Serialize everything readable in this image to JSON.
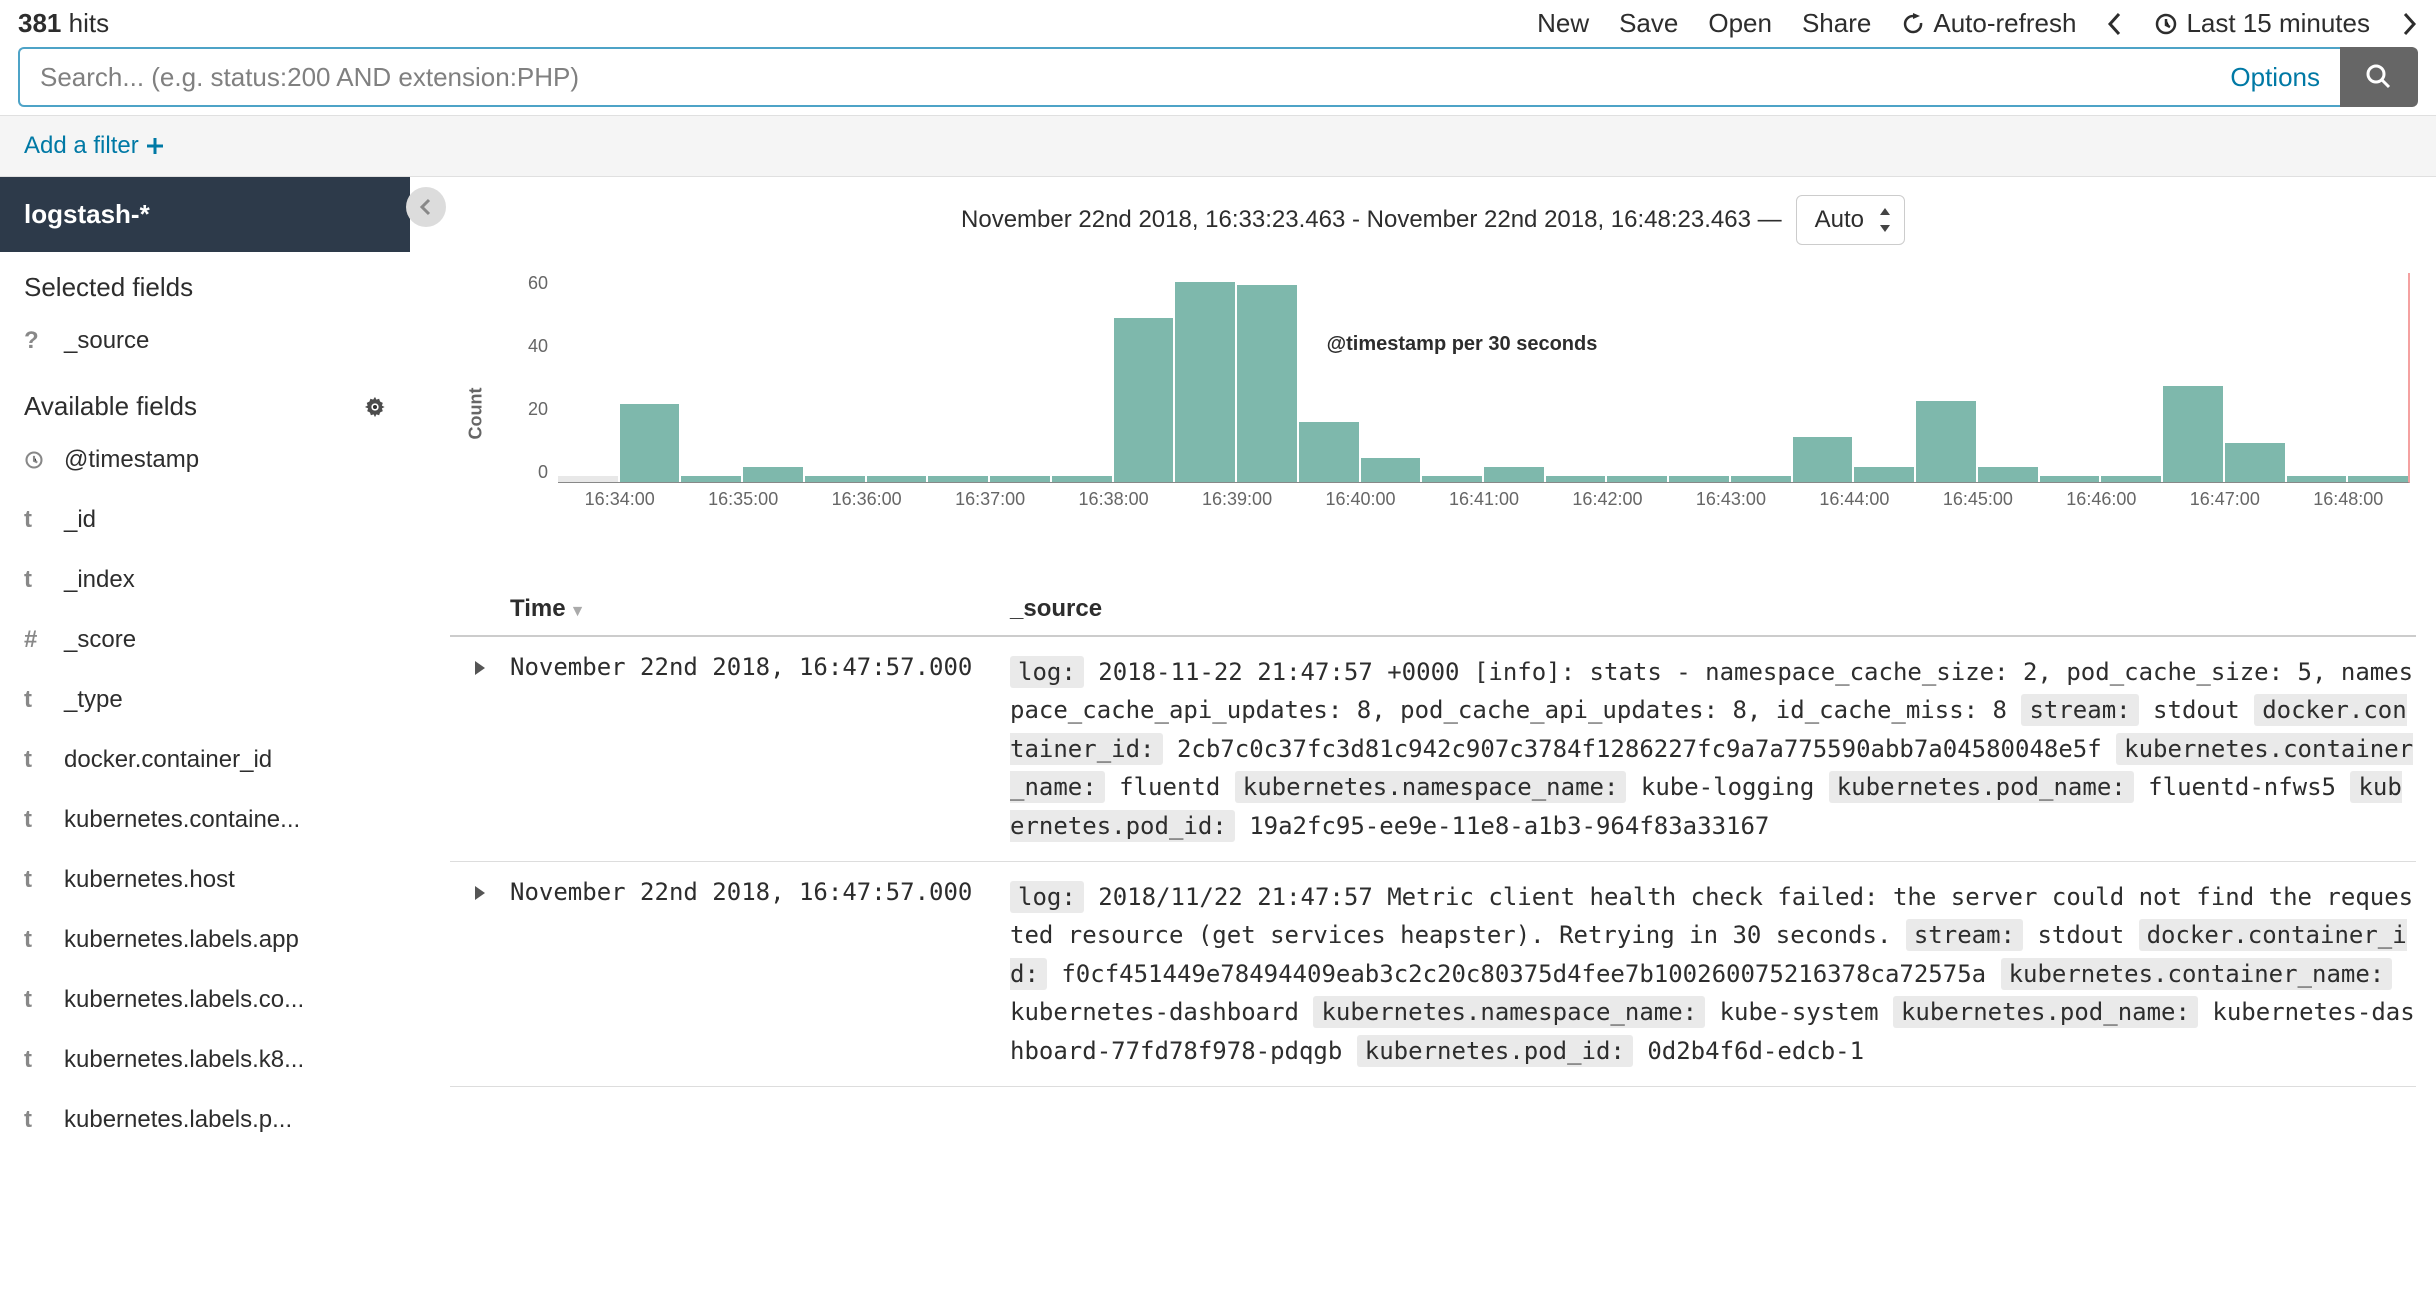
{
  "header": {
    "hit_count": "381",
    "hit_label": "hits",
    "menu": {
      "new": "New",
      "save": "Save",
      "open": "Open",
      "share": "Share",
      "auto_refresh": "Auto-refresh",
      "time_range": "Last 15 minutes"
    }
  },
  "search": {
    "placeholder": "Search... (e.g. status:200 AND extension:PHP)",
    "options": "Options"
  },
  "filter": {
    "add": "Add a filter"
  },
  "sidebar": {
    "index_pattern": "logstash-*",
    "selected_title": "Selected fields",
    "selected": [
      {
        "type": "?",
        "name": "_source"
      }
    ],
    "available_title": "Available fields",
    "available": [
      {
        "type": "clock",
        "name": "@timestamp"
      },
      {
        "type": "t",
        "name": "_id"
      },
      {
        "type": "t",
        "name": "_index"
      },
      {
        "type": "#",
        "name": "_score"
      },
      {
        "type": "t",
        "name": "_type"
      },
      {
        "type": "t",
        "name": "docker.container_id"
      },
      {
        "type": "t",
        "name": "kubernetes.containe..."
      },
      {
        "type": "t",
        "name": "kubernetes.host"
      },
      {
        "type": "t",
        "name": "kubernetes.labels.app"
      },
      {
        "type": "t",
        "name": "kubernetes.labels.co..."
      },
      {
        "type": "t",
        "name": "kubernetes.labels.k8..."
      },
      {
        "type": "t",
        "name": "kubernetes.labels.p..."
      }
    ]
  },
  "histogram": {
    "title": "November 22nd 2018, 16:33:23.463 - November 22nd 2018, 16:48:23.463 —",
    "interval": "Auto",
    "ylabel": "Count",
    "xaxis_label": "@timestamp per 30 seconds"
  },
  "chart_data": {
    "type": "bar",
    "categories": [
      "16:33:30",
      "16:34:00",
      "16:34:30",
      "16:35:00",
      "16:35:30",
      "16:36:00",
      "16:36:30",
      "16:37:00",
      "16:37:30",
      "16:38:00",
      "16:38:30",
      "16:39:00",
      "16:39:30",
      "16:40:00",
      "16:40:30",
      "16:41:00",
      "16:41:30",
      "16:42:00",
      "16:42:30",
      "16:43:00",
      "16:43:30",
      "16:44:00",
      "16:44:30",
      "16:45:00",
      "16:45:30",
      "16:46:00",
      "16:46:30",
      "16:47:00",
      "16:47:30",
      "16:48:00"
    ],
    "values": [
      2,
      26,
      2,
      5,
      2,
      2,
      2,
      2,
      2,
      55,
      67,
      66,
      20,
      8,
      2,
      5,
      2,
      2,
      2,
      2,
      15,
      5,
      27,
      5,
      2,
      2,
      32,
      13,
      2,
      2
    ],
    "xticks": [
      "16:34:00",
      "16:35:00",
      "16:36:00",
      "16:37:00",
      "16:38:00",
      "16:39:00",
      "16:40:00",
      "16:41:00",
      "16:42:00",
      "16:43:00",
      "16:44:00",
      "16:45:00",
      "16:46:00",
      "16:47:00",
      "16:48:00"
    ],
    "yticks": [
      "60",
      "40",
      "20",
      "0"
    ],
    "ylim": [
      0,
      70
    ],
    "xlabel": "@timestamp per 30 seconds",
    "ylabel": "Count",
    "title": "November 22nd 2018, 16:33:23.463 - November 22nd 2018, 16:48:23.463"
  },
  "table": {
    "columns": {
      "time": "Time",
      "source": "_source"
    },
    "rows": [
      {
        "time": "November 22nd 2018, 16:47:57.000",
        "fields": [
          {
            "k": "log:",
            "v": "2018-11-22 21:47:57 +0000 [info]: stats - namespace_cache_size: 2, pod_cache_size: 5, namespace_cache_api_updates: 8, pod_cache_api_updates: 8, id_cache_miss: 8"
          },
          {
            "k": "stream:",
            "v": "stdout"
          },
          {
            "k": "docker.container_id:",
            "v": "2cb7c0c37fc3d81c942c907c3784f1286227fc9a7a775590abb7a04580048e5f"
          },
          {
            "k": "kubernetes.container_name:",
            "v": "fluentd"
          },
          {
            "k": "kubernetes.namespace_name:",
            "v": "kube-logging"
          },
          {
            "k": "kubernetes.pod_name:",
            "v": "fluentd-nfws5"
          },
          {
            "k": "kubernetes.pod_id:",
            "v": "19a2fc95-ee9e-11e8-a1b3-964f83a33167"
          }
        ]
      },
      {
        "time": "November 22nd 2018, 16:47:57.000",
        "fields": [
          {
            "k": "log:",
            "v": "2018/11/22 21:47:57 Metric client health check failed: the server could not find the requested resource (get services heapster). Retrying in 30 seconds."
          },
          {
            "k": "stream:",
            "v": "stdout"
          },
          {
            "k": "docker.container_id:",
            "v": "f0cf451449e78494409eab3c2c20c80375d4fee7b100260075216378ca72575a"
          },
          {
            "k": "kubernetes.container_name:",
            "v": "kubernetes-dashboard"
          },
          {
            "k": "kubernetes.namespace_name:",
            "v": "kube-system"
          },
          {
            "k": "kubernetes.pod_name:",
            "v": "kubernetes-dashboard-77fd78f978-pdqgb"
          },
          {
            "k": "kubernetes.pod_id:",
            "v": "0d2b4f6d-edcb-1"
          }
        ]
      }
    ]
  }
}
